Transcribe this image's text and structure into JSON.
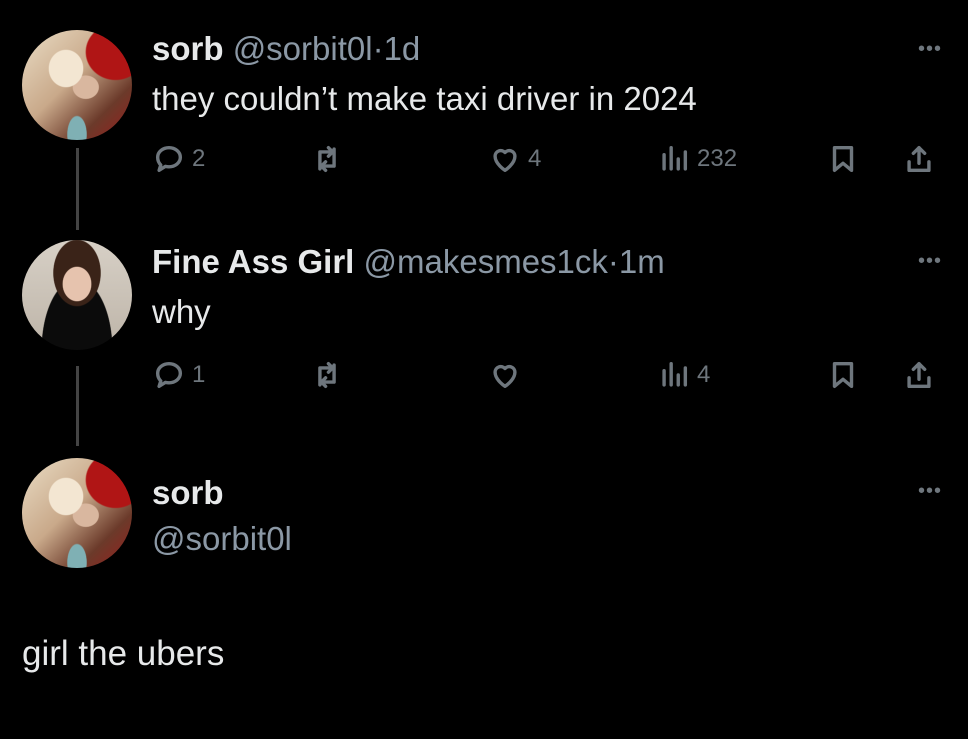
{
  "tweet1": {
    "name": "sorb",
    "handle": "@sorbit0l",
    "dot": "·",
    "time": "1d",
    "text": "they couldn’t make taxi driver in 2024",
    "replies": "2",
    "likes": "4",
    "views": "232"
  },
  "tweet2": {
    "name": "Fine Ass Girl",
    "handle": "@makesmes1ck",
    "dot": "·",
    "time": "1m",
    "text": "why",
    "replies": "1",
    "views": "4"
  },
  "reply_card": {
    "name": "sorb",
    "handle": "@sorbit0l"
  },
  "caption": "girl the ubers",
  "more_label": "•••",
  "icons": [
    "reply-icon",
    "retweet-icon",
    "like-icon",
    "views-icon",
    "bookmark-icon",
    "share-icon"
  ],
  "colors": {
    "background": "#000000",
    "text": "#e7e9ea",
    "muted": "#6e767d",
    "handle": "#8b98a5"
  }
}
